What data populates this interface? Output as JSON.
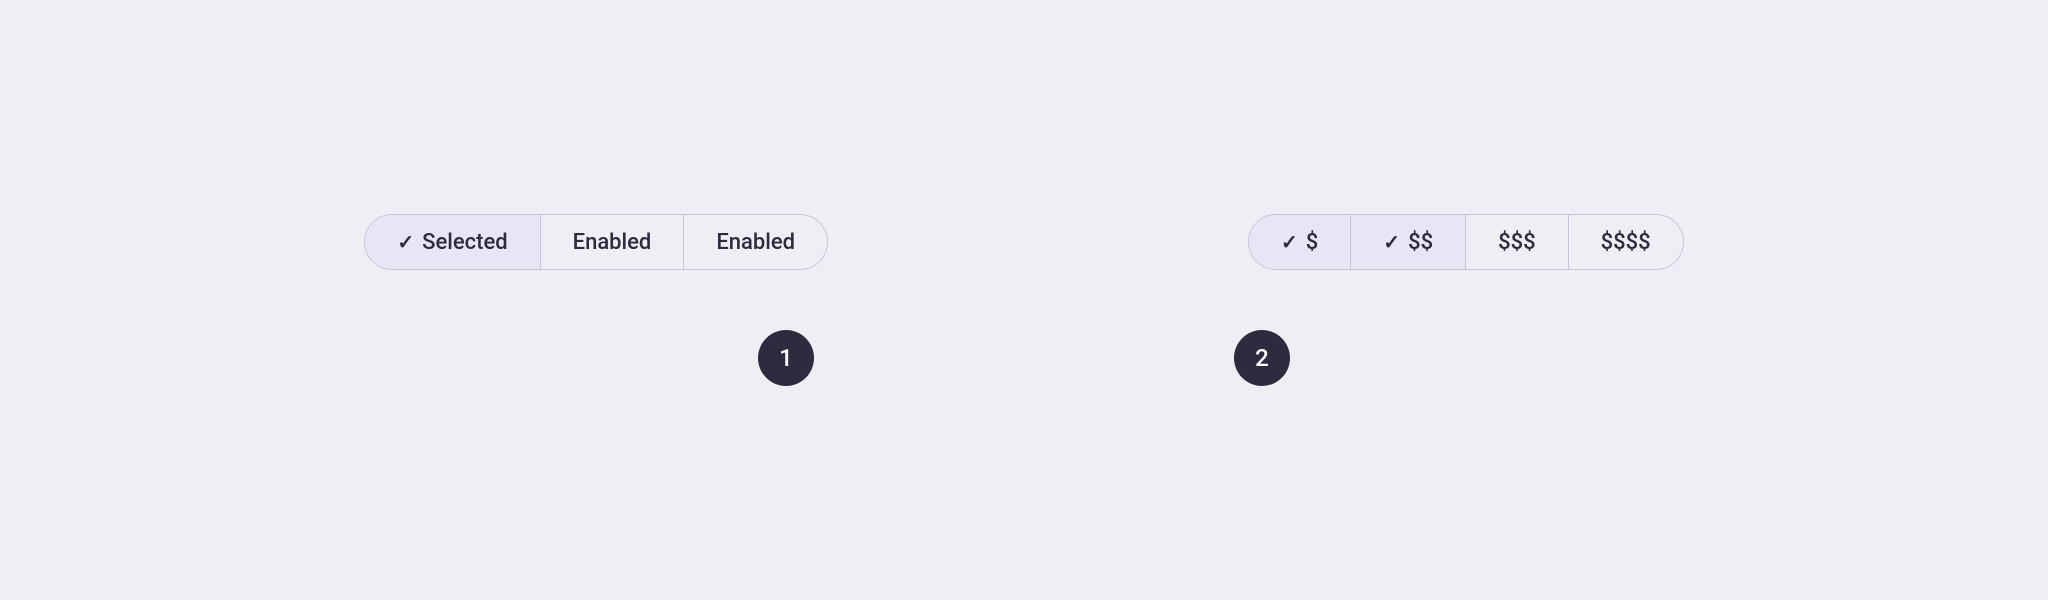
{
  "background_color": "#f0eef5",
  "group1": {
    "segments": [
      {
        "id": "selected",
        "label": "Selected",
        "checked": true,
        "enabled": true
      },
      {
        "id": "enabled1",
        "label": "Enabled",
        "checked": false,
        "enabled": true
      },
      {
        "id": "enabled2",
        "label": "Enabled",
        "checked": false,
        "enabled": true
      }
    ],
    "badge": "1"
  },
  "group2": {
    "segments": [
      {
        "id": "dollar1",
        "label": "$",
        "checked": true,
        "enabled": true
      },
      {
        "id": "dollar2",
        "label": "$$",
        "checked": true,
        "enabled": true
      },
      {
        "id": "dollar3",
        "label": "$$$",
        "checked": false,
        "enabled": true
      },
      {
        "id": "dollar4",
        "label": "$$$$",
        "checked": false,
        "enabled": true
      }
    ],
    "badge": "2"
  }
}
